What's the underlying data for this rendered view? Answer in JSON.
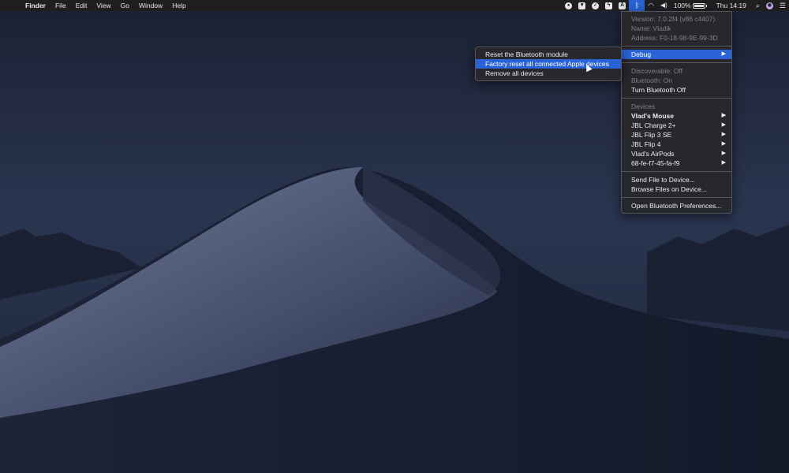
{
  "menubar": {
    "apple_icon": "apple-logo-icon",
    "app_name": "Finder",
    "menus": [
      "File",
      "Edit",
      "View",
      "Go",
      "Window",
      "Help"
    ],
    "status": {
      "battery_percent": "100%",
      "clock": "Thu 14:19"
    }
  },
  "bluetooth_menu": {
    "version": "Version: 7.0.2f4 (v86 c4407)",
    "name": "Name: Vladik",
    "address": "Address: F0-18-98-9E-99-3D",
    "debug_label": "Debug",
    "discoverable": "Discoverable: Off",
    "bluetooth_state": "Bluetooth: On",
    "turn_off": "Turn Bluetooth Off",
    "devices_header": "Devices",
    "devices": [
      "Vlad's Mouse",
      "JBL Charge 2+",
      "JBL Flip 3 SE",
      "JBL Flip 4",
      "Vlad's AirPods",
      "68-fe-f7-45-fa-f9"
    ],
    "send_file": "Send File to Device...",
    "browse_files": "Browse Files on Device...",
    "open_prefs": "Open Bluetooth Preferences..."
  },
  "debug_submenu": {
    "items": [
      "Reset the Bluetooth module",
      "Factory reset all connected Apple devices",
      "Remove all devices"
    ]
  },
  "colors": {
    "menubar_bg": "#1f1f22",
    "highlight": "#2a63d6",
    "menu_bg": "#28282c"
  }
}
